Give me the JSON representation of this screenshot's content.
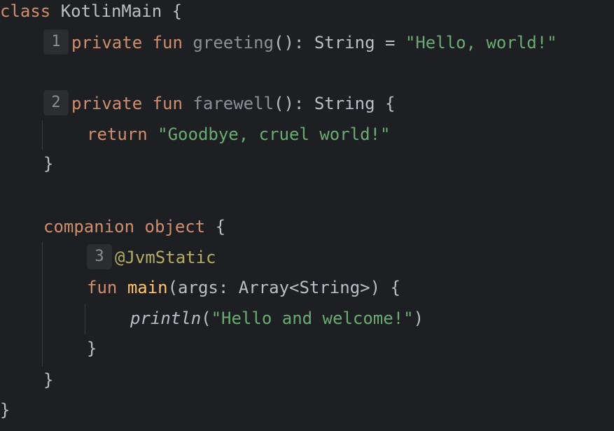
{
  "editor": {
    "colors": {
      "background": "#1e1f22",
      "keyword": "#cf8e6d",
      "string": "#6aab73",
      "function_declaration": "#ffc66d",
      "unused_function": "#8c8f94",
      "annotation": "#b3ae60",
      "default_text": "#bcbec4",
      "badge_background": "#2b2d30"
    },
    "lines": {
      "l1": {
        "kw": "class",
        "name": "KotlinMain",
        "brace": "{"
      },
      "l2": {
        "badge": "1",
        "kw1": "private",
        "kw2": "fun",
        "name": "greeting",
        "parens": "():",
        "type": "String",
        "eq": "=",
        "str": "\"Hello, world!\""
      },
      "l3": {
        "badge": "2",
        "kw1": "private",
        "kw2": "fun",
        "name": "farewell",
        "parens": "():",
        "type": "String",
        "brace": "{"
      },
      "l4": {
        "kw": "return",
        "str": "\"Goodbye, cruel world!\""
      },
      "l5": {
        "brace": "}"
      },
      "l6": {
        "kw1": "companion",
        "kw2": "object",
        "brace": "{"
      },
      "l7": {
        "badge": "3",
        "annotation": "@JvmStatic"
      },
      "l8": {
        "kw": "fun",
        "name": "main",
        "open": "(args:",
        "type": "Array<String>)",
        "brace": "{"
      },
      "l9": {
        "call": "println",
        "open": "(",
        "str": "\"Hello and welcome!\"",
        "close": ")"
      },
      "l10": {
        "brace": "}"
      },
      "l11": {
        "brace": "}"
      },
      "l12": {
        "brace": "}"
      }
    }
  }
}
